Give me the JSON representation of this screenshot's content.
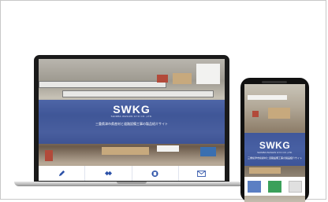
{
  "laptop": {
    "brand": "SWKG",
    "brand_sub": "SHIMBA WASHIN GYO CO.,LTD.",
    "tagline": "三重県津市県産材と道路設備工事の製品紹介サイト",
    "nav_icons": [
      "pencil-icon",
      "handshake-icon",
      "document-icon",
      "mail-icon"
    ]
  },
  "phone": {
    "brand": "SWKG",
    "brand_sub": "SHIMBA WASHIN GYO CO.,LTD.",
    "tagline": "三重県津市県産材と道路設備工事の製品紹介サイト"
  },
  "colors": {
    "accent": "#2e4ea5"
  }
}
